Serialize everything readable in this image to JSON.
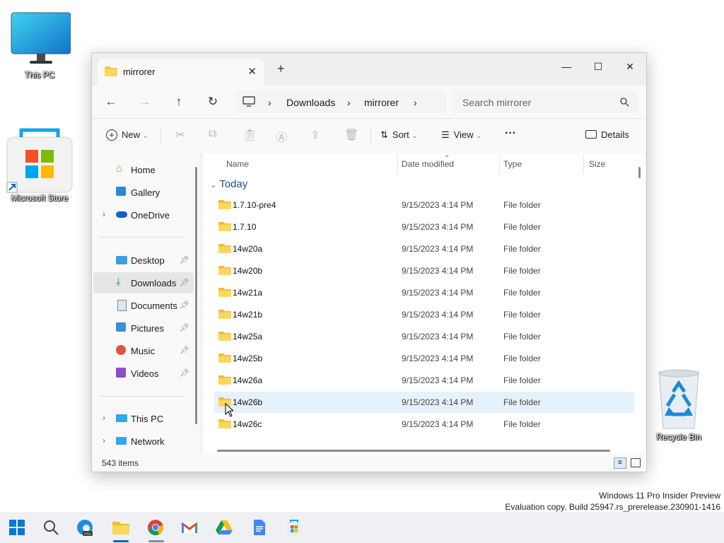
{
  "desktop": {
    "icons": [
      {
        "label": "This PC",
        "icon": "monitor-icon"
      },
      {
        "label": "Microsoft Store",
        "icon": "store-icon"
      },
      {
        "label": "Recycle Bin",
        "icon": "recycle-bin-icon"
      }
    ],
    "watermark": {
      "line1": "Windows 11 Pro Insider Preview",
      "line2": "Evaluation copy. Build 25947.rs_prerelease.230901-1416"
    }
  },
  "window": {
    "tab_title": "mirrorer",
    "new_tab": "+",
    "controls": {
      "minimize": "—",
      "maximize": "☐",
      "close": "✕"
    },
    "breadcrumb": [
      "Downloads",
      "mirrorer"
    ],
    "search_placeholder": "Search mirrorer",
    "commands": {
      "new": "New",
      "sort": "Sort",
      "view": "View",
      "more": "···",
      "details": "Details"
    },
    "nav": {
      "items": [
        {
          "label": "Home"
        },
        {
          "label": "Gallery"
        },
        {
          "label": "OneDrive"
        },
        {
          "label": "Desktop"
        },
        {
          "label": "Downloads"
        },
        {
          "label": "Documents"
        },
        {
          "label": "Pictures"
        },
        {
          "label": "Music"
        },
        {
          "label": "Videos"
        },
        {
          "label": "This PC"
        },
        {
          "label": "Network"
        }
      ],
      "selected": "Downloads"
    },
    "columns": [
      "Name",
      "Date modified",
      "Type",
      "Size"
    ],
    "group": "Today",
    "files": [
      {
        "name": "1.7.10-pre4",
        "date": "9/15/2023 4:14 PM",
        "type": "File folder"
      },
      {
        "name": "1.7.10",
        "date": "9/15/2023 4:14 PM",
        "type": "File folder"
      },
      {
        "name": "14w20a",
        "date": "9/15/2023 4:14 PM",
        "type": "File folder"
      },
      {
        "name": "14w20b",
        "date": "9/15/2023 4:14 PM",
        "type": "File folder"
      },
      {
        "name": "14w21a",
        "date": "9/15/2023 4:14 PM",
        "type": "File folder"
      },
      {
        "name": "14w21b",
        "date": "9/15/2023 4:14 PM",
        "type": "File folder"
      },
      {
        "name": "14w25a",
        "date": "9/15/2023 4:14 PM",
        "type": "File folder"
      },
      {
        "name": "14w25b",
        "date": "9/15/2023 4:14 PM",
        "type": "File folder"
      },
      {
        "name": "14w26a",
        "date": "9/15/2023 4:14 PM",
        "type": "File folder"
      },
      {
        "name": "14w26b",
        "date": "9/15/2023 4:14 PM",
        "type": "File folder"
      },
      {
        "name": "14w26c",
        "date": "9/15/2023 4:14 PM",
        "type": "File folder"
      }
    ],
    "selected_file": "14w26b",
    "status": "543 items"
  },
  "taskbar": {
    "apps": [
      "start-icon",
      "search-icon",
      "edge-beta-icon",
      "file-explorer-icon",
      "chrome-icon",
      "gmail-icon",
      "google-drive-icon",
      "google-docs-icon",
      "store-icon"
    ],
    "active": "file-explorer-icon"
  },
  "colors": {
    "accent": "#0067c0",
    "folder": "#f8c73e",
    "selection": "#e5f1fb"
  }
}
